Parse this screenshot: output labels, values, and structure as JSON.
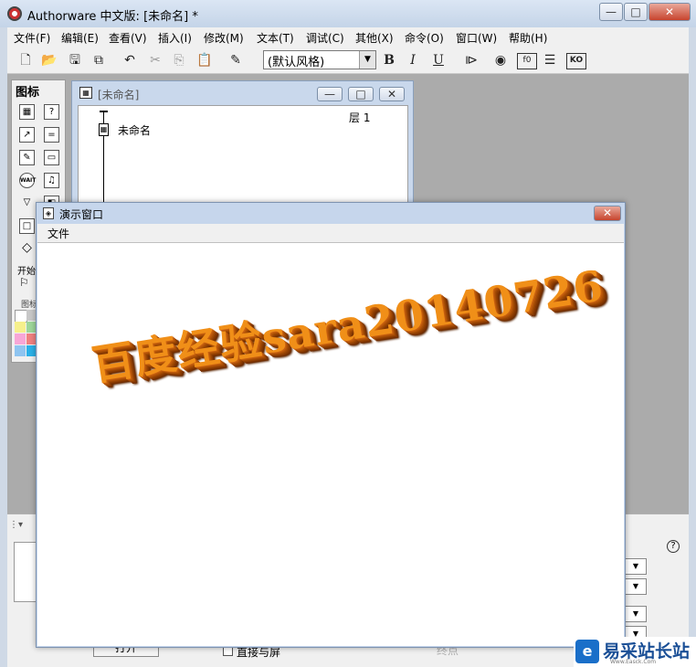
{
  "app": {
    "title": "Authorware 中文版: [未命名] *",
    "controls": {
      "minimize": "—",
      "maximize": "□",
      "close": "✕"
    }
  },
  "menu": [
    "文件(F)",
    "编辑(E)",
    "查看(V)",
    "插入(I)",
    "修改(M)",
    "文本(T)",
    "调试(C)",
    "其他(X)",
    "命令(O)",
    "窗口(W)",
    "帮助(H)"
  ],
  "toolbar": {
    "style_value": "(默认风格)",
    "bold": "B",
    "italic": "I",
    "underline": "U",
    "fn_label": "f0",
    "ko_label": "KO"
  },
  "palette": {
    "title": "图标",
    "wait_label": "WAIT",
    "start_label": "开始",
    "colors_label": "图标"
  },
  "flowline": {
    "title": "[未命名]",
    "level_label": "层 1",
    "icon_label": "未命名"
  },
  "presentation": {
    "title": "演示窗口",
    "menu": [
      "文件"
    ],
    "banner": "百度经验sara20140726"
  },
  "props": {
    "open_button": "打开",
    "direct_to_screen": "直接与屏",
    "help": "?",
    "faded_label": "终点"
  },
  "watermark": {
    "text": "易采站长站",
    "sub": "Www.Easck.Com"
  }
}
